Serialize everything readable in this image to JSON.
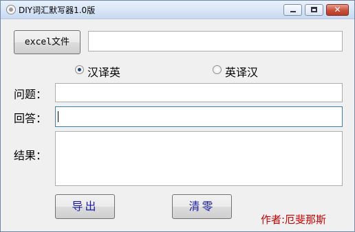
{
  "window": {
    "title": "DIY词汇默写器1.0版",
    "controls": [
      "minimize",
      "maximize",
      "close"
    ],
    "close_glyph": "✕"
  },
  "file": {
    "button_label": "excel文件",
    "path_value": ""
  },
  "mode": {
    "options": [
      {
        "label": "汉译英",
        "selected": true
      },
      {
        "label": "英译汉",
        "selected": false
      }
    ]
  },
  "fields": {
    "question_label": "问题：",
    "question_value": "",
    "answer_label": "回答：",
    "answer_value": "",
    "result_label": "结果：",
    "result_value": ""
  },
  "actions": {
    "export_label": "导出",
    "clear_label": "清零"
  },
  "author": "作者:厄斐那斯",
  "colors": {
    "action_text": "#1a1aa8",
    "author_text": "#cc0000",
    "focus_border": "#3c7fb1"
  }
}
